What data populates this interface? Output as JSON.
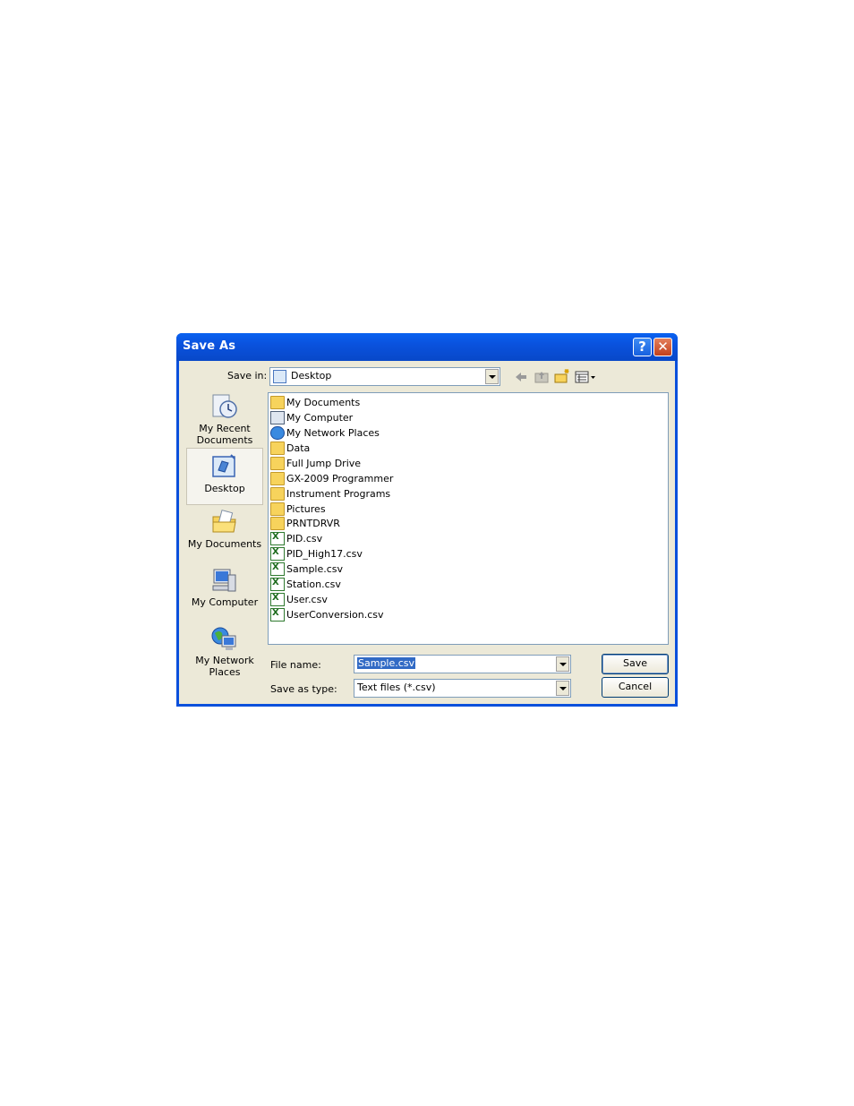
{
  "window": {
    "title": "Save As",
    "help_glyph": "?",
    "close_glyph": "✕"
  },
  "toolbar": {
    "save_in_label": "Save in:",
    "save_in_value": "Desktop",
    "icons": [
      "back-arrow-icon",
      "up-folder-icon",
      "new-folder-icon",
      "view-menu-icon"
    ]
  },
  "places": [
    {
      "label": "My Recent Documents",
      "icon": "recent-documents-icon"
    },
    {
      "label": "Desktop",
      "icon": "desktop-icon",
      "selected": true
    },
    {
      "label": "My Documents",
      "icon": "my-documents-icon"
    },
    {
      "label": "My Computer",
      "icon": "my-computer-icon"
    },
    {
      "label": "My Network Places",
      "icon": "network-places-icon"
    }
  ],
  "files": [
    {
      "name": "My Documents",
      "type": "special-documents"
    },
    {
      "name": "My Computer",
      "type": "computer"
    },
    {
      "name": "My Network Places",
      "type": "network"
    },
    {
      "name": "Data",
      "type": "folder"
    },
    {
      "name": "Full Jump Drive",
      "type": "folder"
    },
    {
      "name": "GX-2009 Programmer",
      "type": "folder"
    },
    {
      "name": "Instrument Programs",
      "type": "folder"
    },
    {
      "name": "Pictures",
      "type": "folder"
    },
    {
      "name": "PRNTDRVR",
      "type": "folder"
    },
    {
      "name": "PID.csv",
      "type": "csv"
    },
    {
      "name": "PID_High17.csv",
      "type": "csv"
    },
    {
      "name": "Sample.csv",
      "type": "csv"
    },
    {
      "name": "Station.csv",
      "type": "csv"
    },
    {
      "name": "User.csv",
      "type": "csv"
    },
    {
      "name": "UserConversion.csv",
      "type": "csv"
    }
  ],
  "form": {
    "file_name_label": "File name:",
    "file_name_value": "Sample.csv",
    "save_type_label": "Save as type:",
    "save_type_value": "Text files (*.csv)"
  },
  "buttons": {
    "save": "Save",
    "cancel": "Cancel"
  }
}
